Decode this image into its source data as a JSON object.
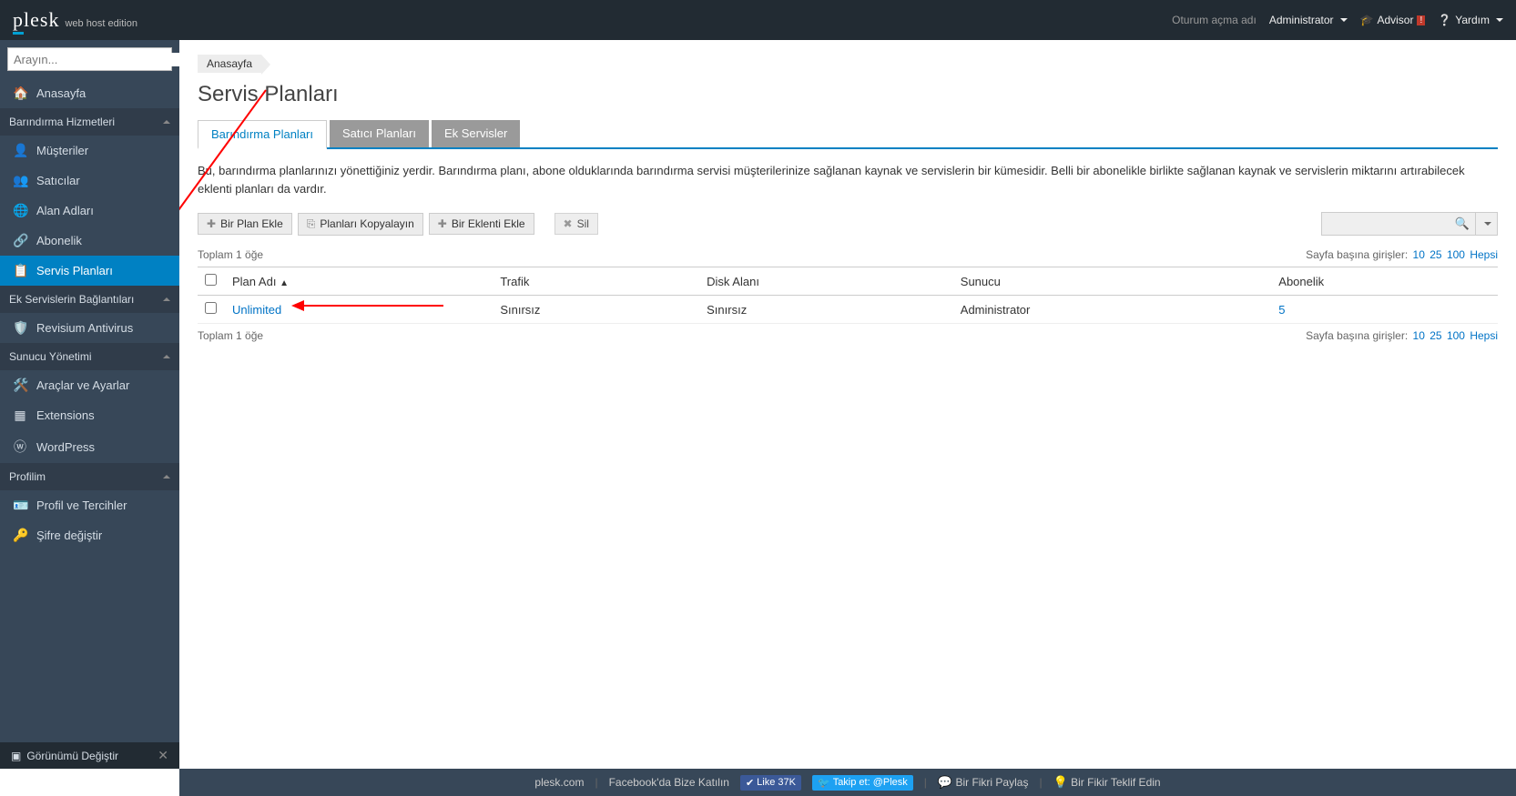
{
  "brand": {
    "name": "plesk",
    "edition": "web host edition"
  },
  "header": {
    "login_label": "Oturum açma adı",
    "user": "Administrator",
    "advisor": "Advisor",
    "help": "Yardım"
  },
  "search": {
    "placeholder": "Arayın..."
  },
  "nav": {
    "home": "Anasayfa",
    "group_hosting": "Barındırma Hizmetleri",
    "hosting_items": {
      "customers": "Müşteriler",
      "resellers": "Satıcılar",
      "domains": "Alan Adları",
      "subscriptions": "Abonelik",
      "service_plans": "Servis Planları"
    },
    "group_ext": "Ek Servislerin Bağlantıları",
    "ext_items": {
      "revisium": "Revisium Antivirus"
    },
    "group_server": "Sunucu Yönetimi",
    "server_items": {
      "tools": "Araçlar ve Ayarlar",
      "extensions": "Extensions",
      "wordpress": "WordPress"
    },
    "group_profile": "Profilim",
    "profile_items": {
      "prefs": "Profil ve Tercihler",
      "password": "Şifre değiştir"
    }
  },
  "sidebar_footer": {
    "view_switch": "Görünümü Değiştir"
  },
  "breadcrumb": {
    "home": "Anasayfa"
  },
  "page": {
    "title": "Servis Planları"
  },
  "tabs": {
    "hosting": "Barındırma Planları",
    "reseller": "Satıcı Planları",
    "addons": "Ek Servisler"
  },
  "description": "Bu, barındırma planlarınızı yönettiğiniz yerdir. Barındırma planı, abone olduklarında barındırma servisi müşterilerinize sağlanan kaynak ve servislerin bir kümesidir. Belli bir abonelikle birlikte sağlanan kaynak ve servislerin miktarını artırabilecek eklenti planları da vardır.",
  "buttons": {
    "add_plan": "Bir Plan Ekle",
    "copy_plans": "Planları Kopyalayın",
    "add_addon": "Bir Eklenti Ekle",
    "delete": "Sil"
  },
  "total": {
    "top": "Toplam 1 öğe",
    "bottom": "Toplam 1 öğe"
  },
  "pager": {
    "label": "Sayfa başına girişler:",
    "o10": "10",
    "o25": "25",
    "o100": "100",
    "all": "Hepsi"
  },
  "columns": {
    "plan_name": "Plan Adı",
    "traffic": "Trafik",
    "disk": "Disk Alanı",
    "server": "Sunucu",
    "subscription": "Abonelik"
  },
  "rows": [
    {
      "name": "Unlimited",
      "traffic": "Sınırsız",
      "disk": "Sınırsız",
      "server": "Administrator",
      "subs": "5"
    }
  ],
  "footer": {
    "plesk": "plesk.com",
    "facebook": "Facebook'da Bize Katılın",
    "like": "Like 37K",
    "twitter": "Takip et: @Plesk",
    "share_idea": "Bir Fikri Paylaş",
    "suggest": "Bir Fikir Teklif Edin"
  }
}
